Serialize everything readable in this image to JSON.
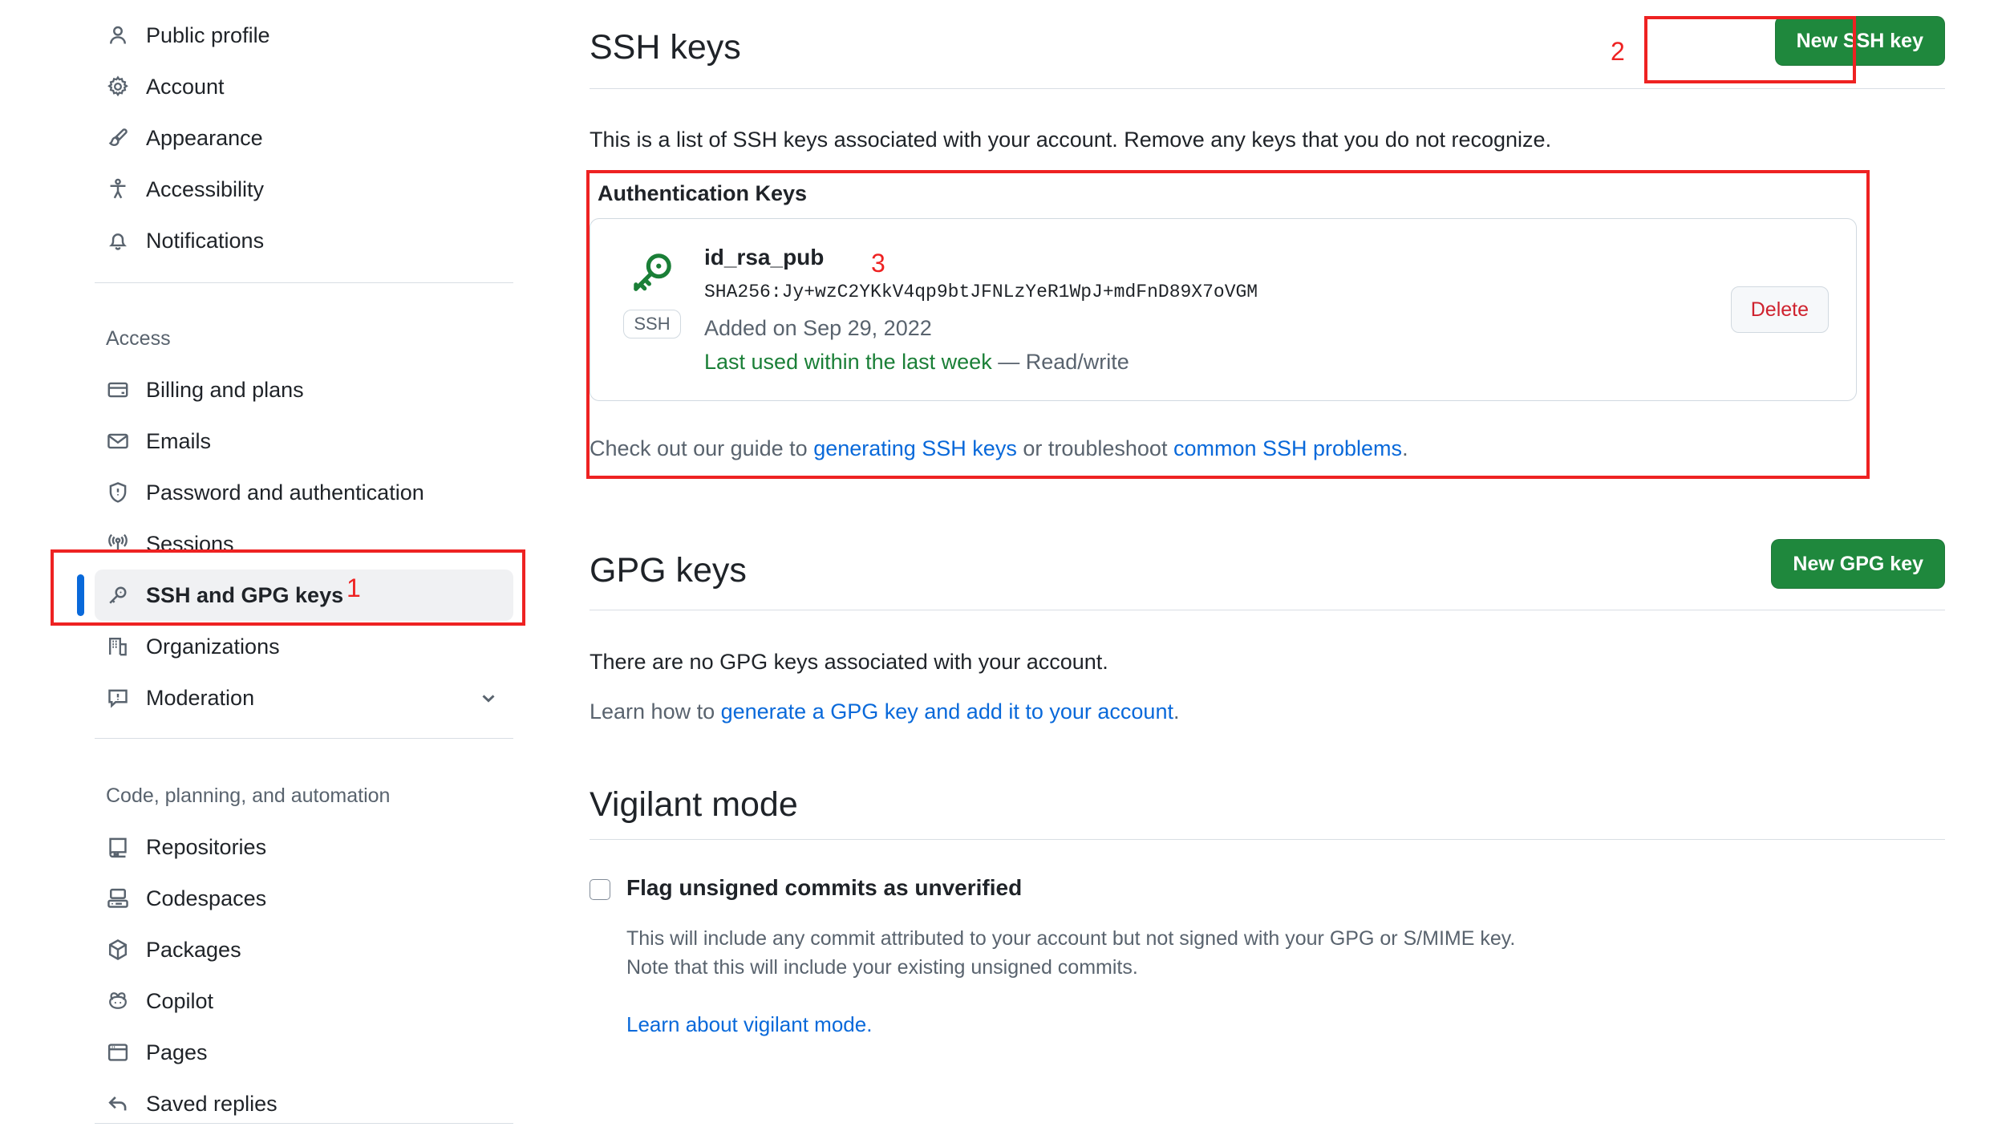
{
  "sidebar": {
    "primary_items": [
      {
        "label": "Public profile",
        "icon": "person-icon"
      },
      {
        "label": "Account",
        "icon": "gear-icon"
      },
      {
        "label": "Appearance",
        "icon": "paintbrush-icon"
      },
      {
        "label": "Accessibility",
        "icon": "accessibility-icon"
      },
      {
        "label": "Notifications",
        "icon": "bell-icon"
      }
    ],
    "access_group_title": "Access",
    "access_items": [
      {
        "label": "Billing and plans",
        "icon": "credit-card-icon"
      },
      {
        "label": "Emails",
        "icon": "mail-icon"
      },
      {
        "label": "Password and authentication",
        "icon": "shield-lock-icon"
      },
      {
        "label": "Sessions",
        "icon": "broadcast-icon"
      },
      {
        "label": "SSH and GPG keys",
        "icon": "key-icon"
      },
      {
        "label": "Organizations",
        "icon": "organization-icon"
      },
      {
        "label": "Moderation",
        "icon": "report-icon"
      }
    ],
    "code_group_title": "Code, planning, and automation",
    "code_items": [
      {
        "label": "Repositories",
        "icon": "repo-icon"
      },
      {
        "label": "Codespaces",
        "icon": "codespaces-icon"
      },
      {
        "label": "Packages",
        "icon": "package-icon"
      },
      {
        "label": "Copilot",
        "icon": "copilot-icon"
      },
      {
        "label": "Pages",
        "icon": "browser-icon"
      },
      {
        "label": "Saved replies",
        "icon": "reply-icon"
      }
    ]
  },
  "ssh_section": {
    "title": "SSH keys",
    "new_key_button": "New SSH key",
    "description": "This is a list of SSH keys associated with your account. Remove any keys that you do not recognize.",
    "auth_keys_title": "Authentication Keys",
    "key": {
      "name": "id_rsa_pub",
      "fingerprint": "SHA256:Jy+wzC2YKkV4qp9btJFNLzYeR1WpJ+mdFnD89X7oVGM",
      "added": "Added on Sep 29, 2022",
      "last_used": "Last used within the last week",
      "access": "— Read/write",
      "badge": "SSH",
      "delete_button": "Delete"
    },
    "guide_prefix": "Check out our guide to ",
    "guide_link_1": "generating SSH keys",
    "guide_middle": " or troubleshoot ",
    "guide_link_2": "common SSH problems",
    "guide_suffix": "."
  },
  "gpg_section": {
    "title": "GPG keys",
    "new_key_button": "New GPG key",
    "empty_text": "There are no GPG keys associated with your account.",
    "learn_prefix": "Learn how to ",
    "learn_link": "generate a GPG key and add it to your account",
    "learn_suffix": "."
  },
  "vigilant_section": {
    "title": "Vigilant mode",
    "checkbox_label": "Flag unsigned commits as unverified",
    "help_line_1": "This will include any commit attributed to your account but not signed with your GPG or S/MIME key.",
    "help_line_2": "Note that this will include your existing unsigned commits.",
    "learn_link": "Learn about vigilant mode."
  },
  "annotations": {
    "marker_1": "1",
    "marker_2": "2",
    "marker_3": "3"
  },
  "colors": {
    "accent_green": "#1f883d",
    "annotation_red": "#ee2222",
    "link_blue": "#0969da",
    "active_blue": "#0969da",
    "danger_red": "#cf222e",
    "success_green": "#1a7f37"
  }
}
